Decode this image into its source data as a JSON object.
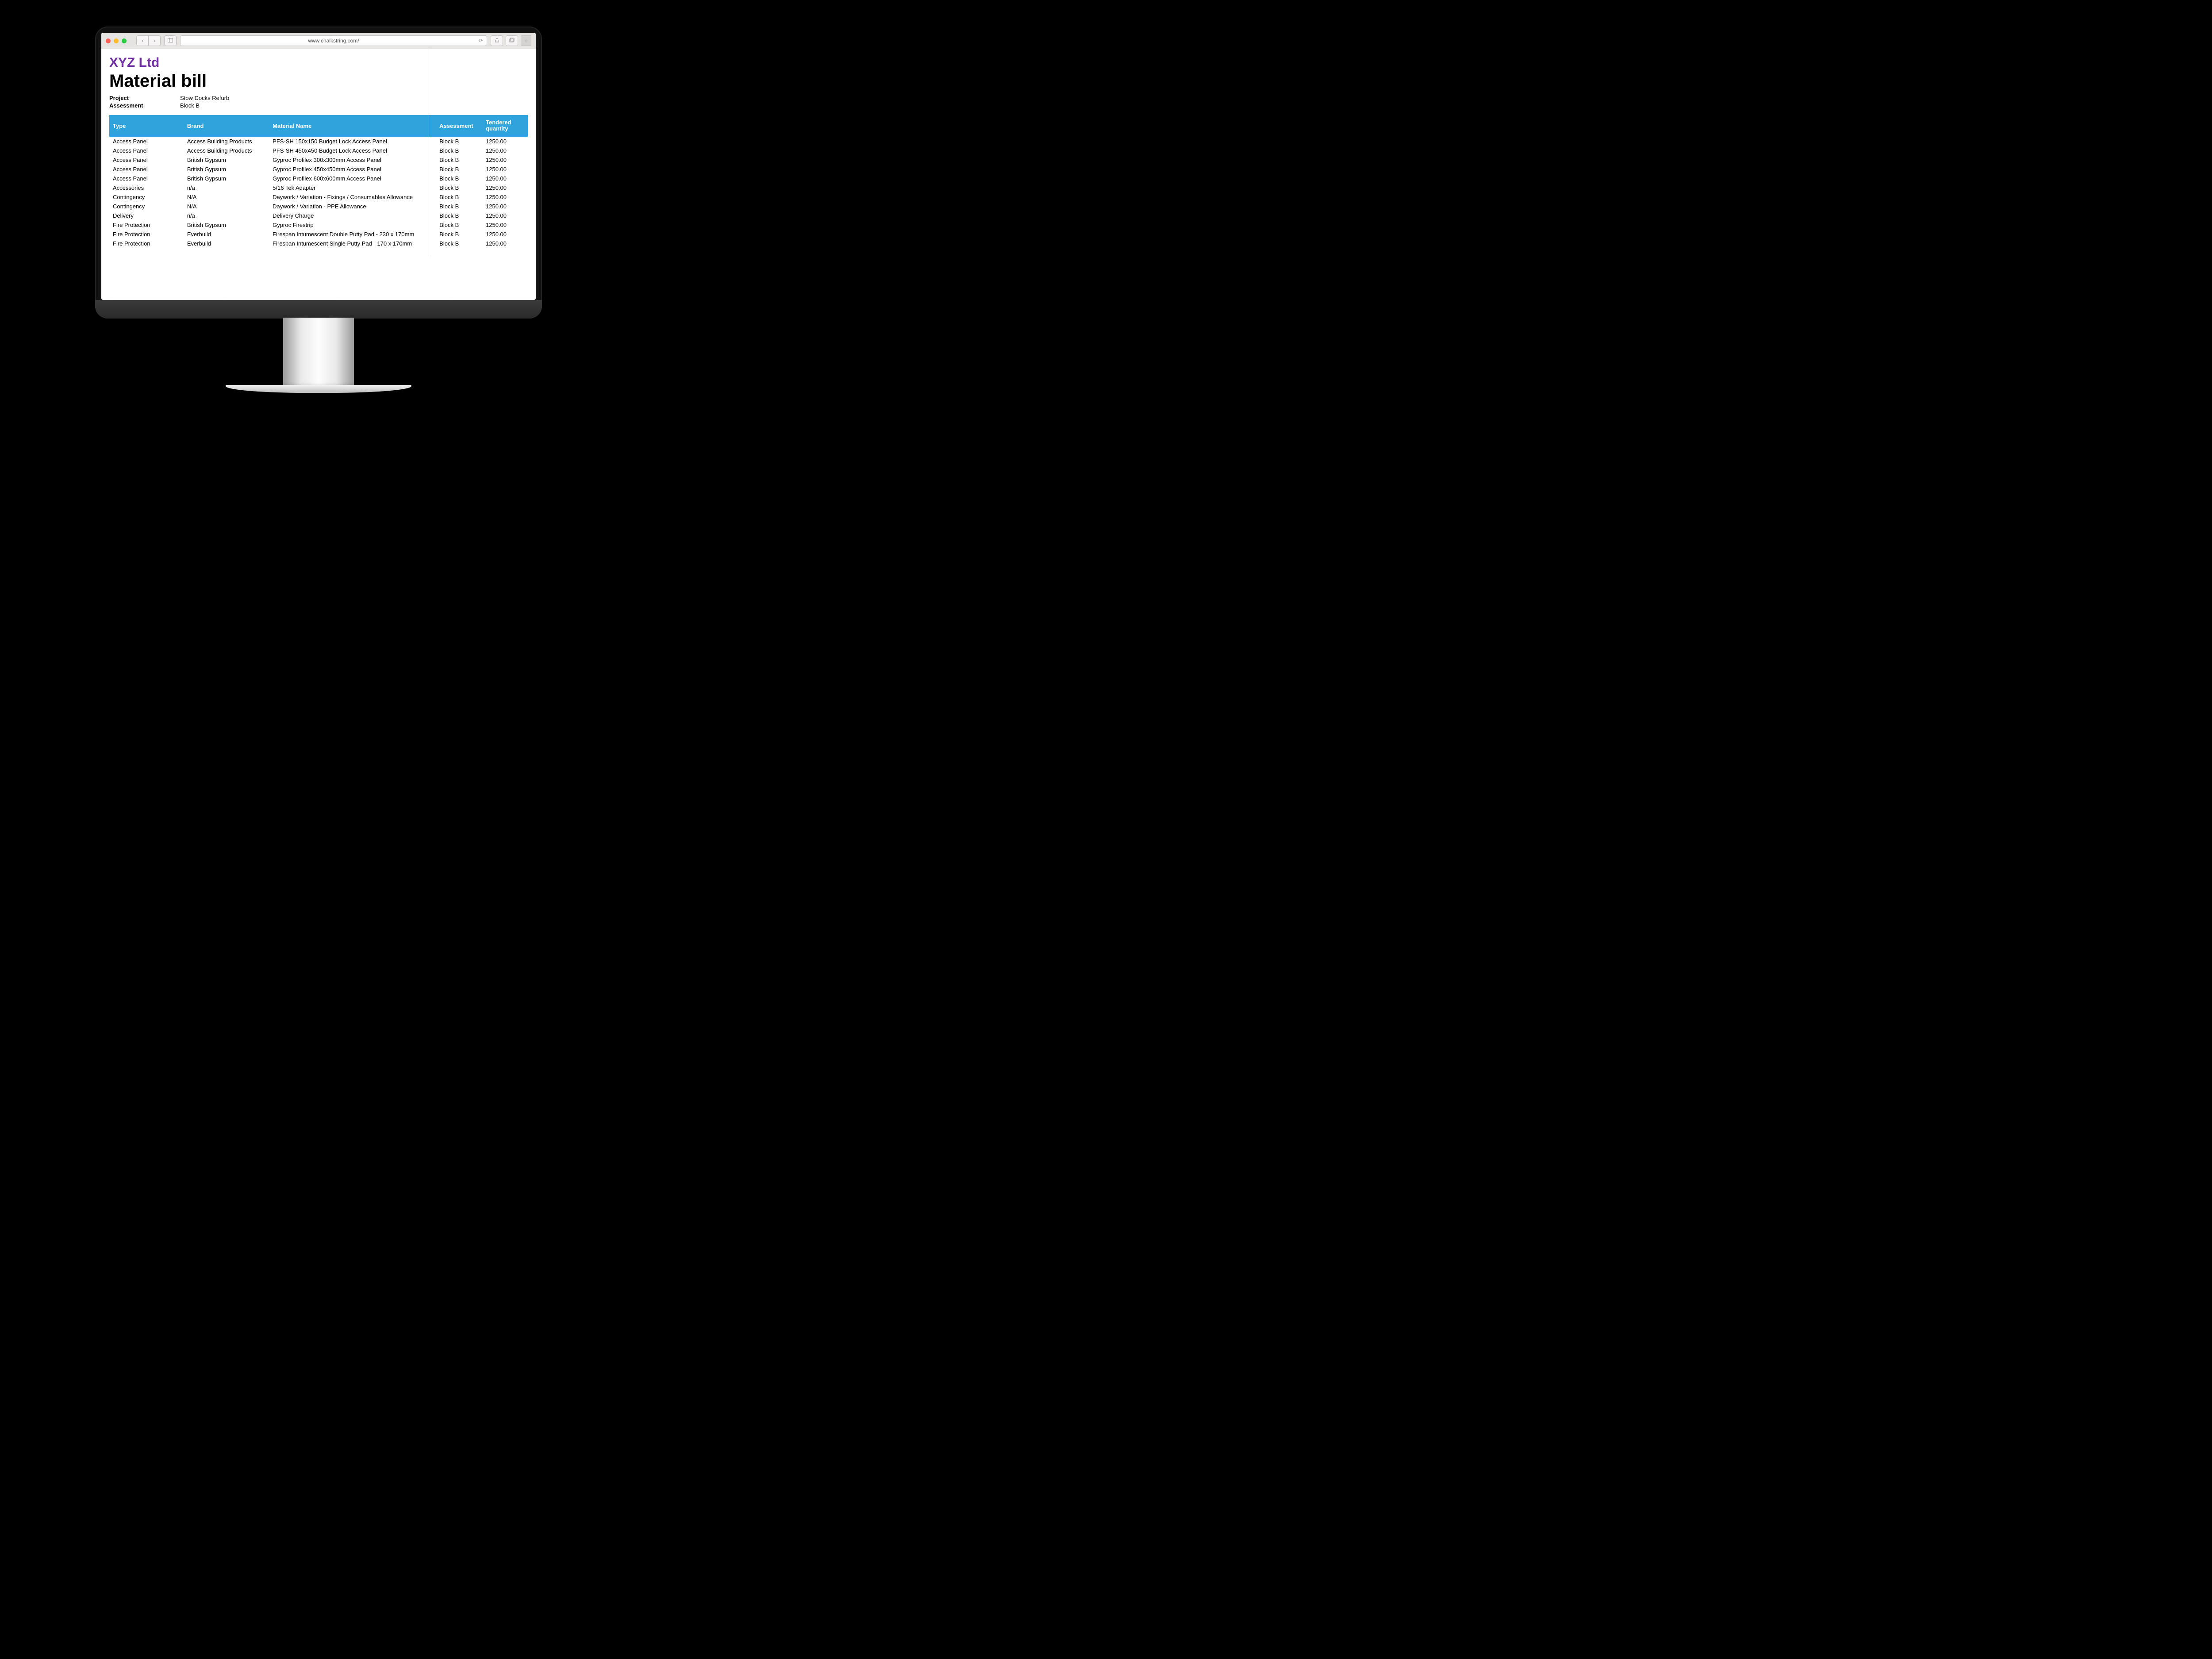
{
  "browser": {
    "url": "www.chalkstring.com/"
  },
  "header": {
    "brand": "XYZ Ltd",
    "title": "Material bill",
    "project_label": "Project",
    "project_value": "Stow Docks Refurb",
    "assessment_label": "Assessment",
    "assessment_value": "Block B"
  },
  "table": {
    "columns": {
      "type": "Type",
      "brand": "Brand",
      "name": "Material Name",
      "assessment": "Assessment",
      "qty": "Tendered quantity"
    },
    "rows": [
      {
        "type": "Access Panel",
        "brand": "Access Building Products",
        "name": "PFS-SH 150x150 Budget Lock Access Panel",
        "assessment": "Block B",
        "qty": "1250.00"
      },
      {
        "type": "Access Panel",
        "brand": "Access Building Products",
        "name": "PFS-SH 450x450 Budget Lock Access Panel",
        "assessment": "Block B",
        "qty": "1250.00"
      },
      {
        "type": "Access Panel",
        "brand": "British Gypsum",
        "name": "Gyproc Profilex 300x300mm Access Panel",
        "assessment": "Block B",
        "qty": "1250.00"
      },
      {
        "type": "Access Panel",
        "brand": "British Gypsum",
        "name": "Gyproc Profilex 450x450mm Access Panel",
        "assessment": "Block B",
        "qty": "1250.00"
      },
      {
        "type": "Access Panel",
        "brand": "British Gypsum",
        "name": "Gyproc Profilex 600x600mm Access Panel",
        "assessment": "Block B",
        "qty": "1250.00"
      },
      {
        "type": "Accessories",
        "brand": "n/a",
        "name": "5/16 Tek Adapter",
        "assessment": "Block B",
        "qty": "1250.00"
      },
      {
        "type": "Contingency",
        "brand": "N/A",
        "name": "Daywork / Variation - Fixings / Consumables Allowance",
        "assessment": "Block B",
        "qty": "1250.00"
      },
      {
        "type": "Contingency",
        "brand": "N/A",
        "name": "Daywork / Variation - PPE Allowance",
        "assessment": "Block B",
        "qty": "1250.00"
      },
      {
        "type": "Delivery",
        "brand": "n/a",
        "name": "Delivery Charge",
        "assessment": "Block B",
        "qty": "1250.00"
      },
      {
        "type": "Fire Protection",
        "brand": "British Gypsum",
        "name": "Gyproc Firestrip",
        "assessment": "Block B",
        "qty": "1250.00"
      },
      {
        "type": "Fire Protection",
        "brand": "Everbuild",
        "name": "Firespan Intumescent Double Putty Pad - 230 x 170mm",
        "assessment": "Block B",
        "qty": "1250.00"
      },
      {
        "type": "Fire Protection",
        "brand": "Everbuild",
        "name": "Firespan Intumescent Single Putty Pad - 170 x 170mm",
        "assessment": "Block B",
        "qty": "1250.00"
      }
    ]
  }
}
